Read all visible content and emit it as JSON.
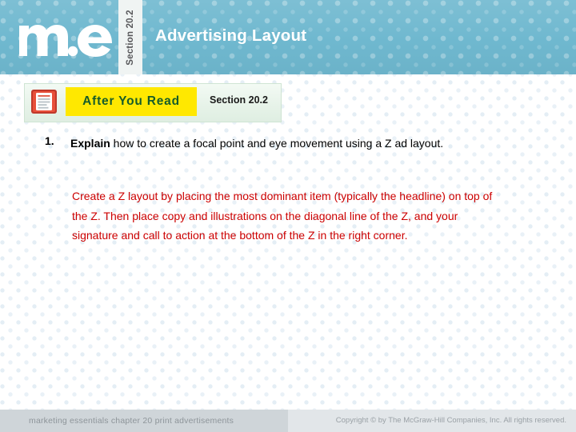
{
  "header": {
    "logo_alt": "me",
    "section_vertical_label": "Section 20.2",
    "title": "Advertising Layout",
    "background_color": "#6fb8cf"
  },
  "banner": {
    "icon_name": "document-notes-icon",
    "label": "After You Read",
    "section": "Section 20.2",
    "highlight_color": "#ffe800",
    "label_text_color": "#165c2a"
  },
  "content": {
    "question_number": "1.",
    "question_lead": "Explain",
    "question_rest": " how to create a focal point and eye movement using a Z ad layout.",
    "answer": "Create a Z layout by placing the most dominant item (typically the headline) on top of the Z. Then place copy and illustrations on the diagonal line of the Z, and your signature and call to action at the bottom of the Z in the right corner.",
    "answer_color": "#cc0000"
  },
  "footer": {
    "left_text": "marketing essentials  chapter 20  print advertisements",
    "right_text": "Copyright © by The McGraw-Hill Companies, Inc. All rights reserved."
  }
}
